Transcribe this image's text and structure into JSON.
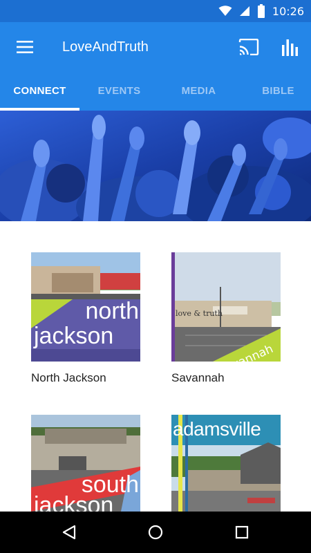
{
  "status_bar": {
    "time": "10:26",
    "icons": [
      "wifi-icon",
      "cell-signal-icon",
      "battery-icon"
    ]
  },
  "app_bar": {
    "title": "LoveAndTruth",
    "icons": [
      "menu-icon",
      "cast-icon",
      "bar-chart-icon"
    ]
  },
  "tabs": [
    {
      "label": "CONNECT",
      "active": true
    },
    {
      "label": "EVENTS",
      "active": false
    },
    {
      "label": "MEDIA",
      "active": false
    },
    {
      "label": "BIBLE",
      "active": false
    }
  ],
  "locations": [
    {
      "name": "North Jackson",
      "thumb_text": [
        "north",
        "jackson"
      ]
    },
    {
      "name": "Savannah",
      "thumb_text": [
        "love & truth",
        "Savannah"
      ]
    },
    {
      "name": "South Jackson",
      "thumb_text": [
        "south",
        "jackson"
      ]
    },
    {
      "name": "Adamsville",
      "thumb_text": [
        "adamsville"
      ]
    }
  ],
  "nav_bar": {
    "icons": [
      "back-icon",
      "home-icon",
      "recents-icon"
    ]
  },
  "colors": {
    "status_bar": "#1c6fd1",
    "primary": "#2486e8",
    "tab_inactive": "#9ec8f5",
    "hero_tint": "#1a3f9e"
  }
}
